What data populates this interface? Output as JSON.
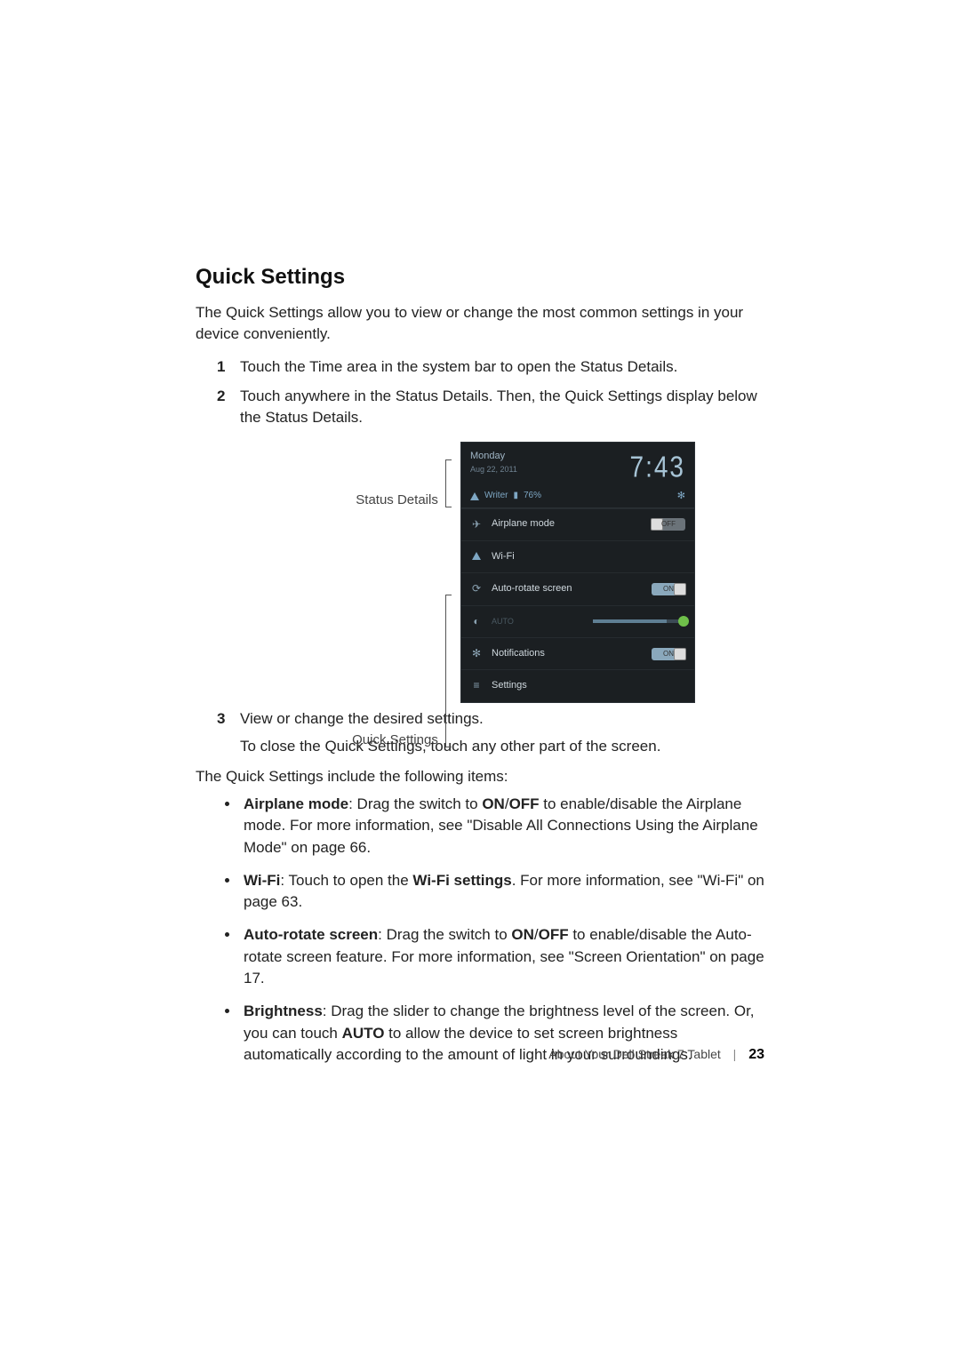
{
  "heading": "Quick Settings",
  "intro": "The Quick Settings allow you to view or change the most common settings in your device conveniently.",
  "steps": {
    "s1_num": "1",
    "s1_text": "Touch the Time area in the system bar to open the Status Details.",
    "s2_num": "2",
    "s2_text": "Touch anywhere in the Status Details. Then, the Quick Settings display below the Status Details.",
    "s3_num": "3",
    "s3_text": "View or change the desired settings.",
    "s3_sub": "To close the Quick Settings, touch any other part of the screen."
  },
  "labels": {
    "status_details": "Status Details",
    "quick_settings": "Quick Settings"
  },
  "shot": {
    "day": "Monday",
    "date": "Aug 22, 2011",
    "time": "7:43",
    "wifi_name": "Writer",
    "battery": "76%",
    "rows": {
      "airplane": "Airplane mode",
      "airplane_state": "OFF",
      "wifi": "Wi-Fi",
      "autorotate": "Auto-rotate screen",
      "autorotate_state": "ON",
      "brightness_auto": "AUTO",
      "notifications": "Notifications",
      "notifications_state": "ON",
      "settings": "Settings"
    }
  },
  "list_intro": "The Quick Settings include the following items:",
  "bullets": {
    "b1_bold": "Airplane mode",
    "b1_mid1": ": Drag the switch to ",
    "b1_on": "ON",
    "b1_slash": "/",
    "b1_off": "OFF",
    "b1_rest": " to enable/disable the Airplane mode. For more information, see \"Disable All Connections Using the Airplane Mode\" on page 66.",
    "b2_bold": "Wi-Fi",
    "b2_mid": ": Touch to open the ",
    "b2_bold2": "Wi-Fi settings",
    "b2_rest": ". For more information, see \"Wi-Fi\" on page 63.",
    "b3_bold": "Auto-rotate screen",
    "b3_mid1": ": Drag the switch to ",
    "b3_on": "ON",
    "b3_slash": "/",
    "b3_off": "OFF",
    "b3_rest": " to enable/disable the Auto-rotate screen feature. For more information, see \"Screen Orientation\" on page 17.",
    "b4_bold": "Brightness",
    "b4_mid": ": Drag the slider to change the brightness level of the screen. Or, you can touch ",
    "b4_auto": "AUTO",
    "b4_rest": " to allow the device to set screen brightness automatically according to the amount of light in your surroundings."
  },
  "footer": {
    "chapter": "About Your Dell Streak 7 Tablet",
    "page": "23"
  }
}
